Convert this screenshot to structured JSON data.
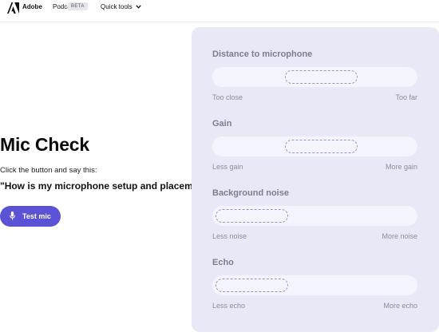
{
  "header": {
    "brand_primary": "Adobe",
    "brand_secondary": "Podcast",
    "badge": "BETA",
    "quick_tools_label": "Quick tools",
    "icons": {
      "logo": "adobe-logo-icon",
      "quick_tools": "chevron-down-icon"
    }
  },
  "main": {
    "title": "Mic Check",
    "instruction": "Click the button and say this:",
    "phrase": "\"How is my microphone setup and placement?\"",
    "test_button_label": "Test mic",
    "test_button_icon": "microphone-icon",
    "accent_color": "#5c52d6"
  },
  "metrics": [
    {
      "label": "Distance to microphone",
      "low": "Too close",
      "high": "Too far",
      "level": 0.55
    },
    {
      "label": "Gain",
      "low": "Less gain",
      "high": "More gain",
      "level": 0.55
    },
    {
      "label": "Background noise",
      "low": "Less noise",
      "high": "More noise",
      "level": 0.0
    },
    {
      "label": "Echo",
      "low": "Less echo",
      "high": "More echo",
      "level": 0.0
    }
  ],
  "colors": {
    "panel_background": "#e9e8f7",
    "track_background": "#f4f4fd",
    "indicator_border": "#9a92cf"
  }
}
